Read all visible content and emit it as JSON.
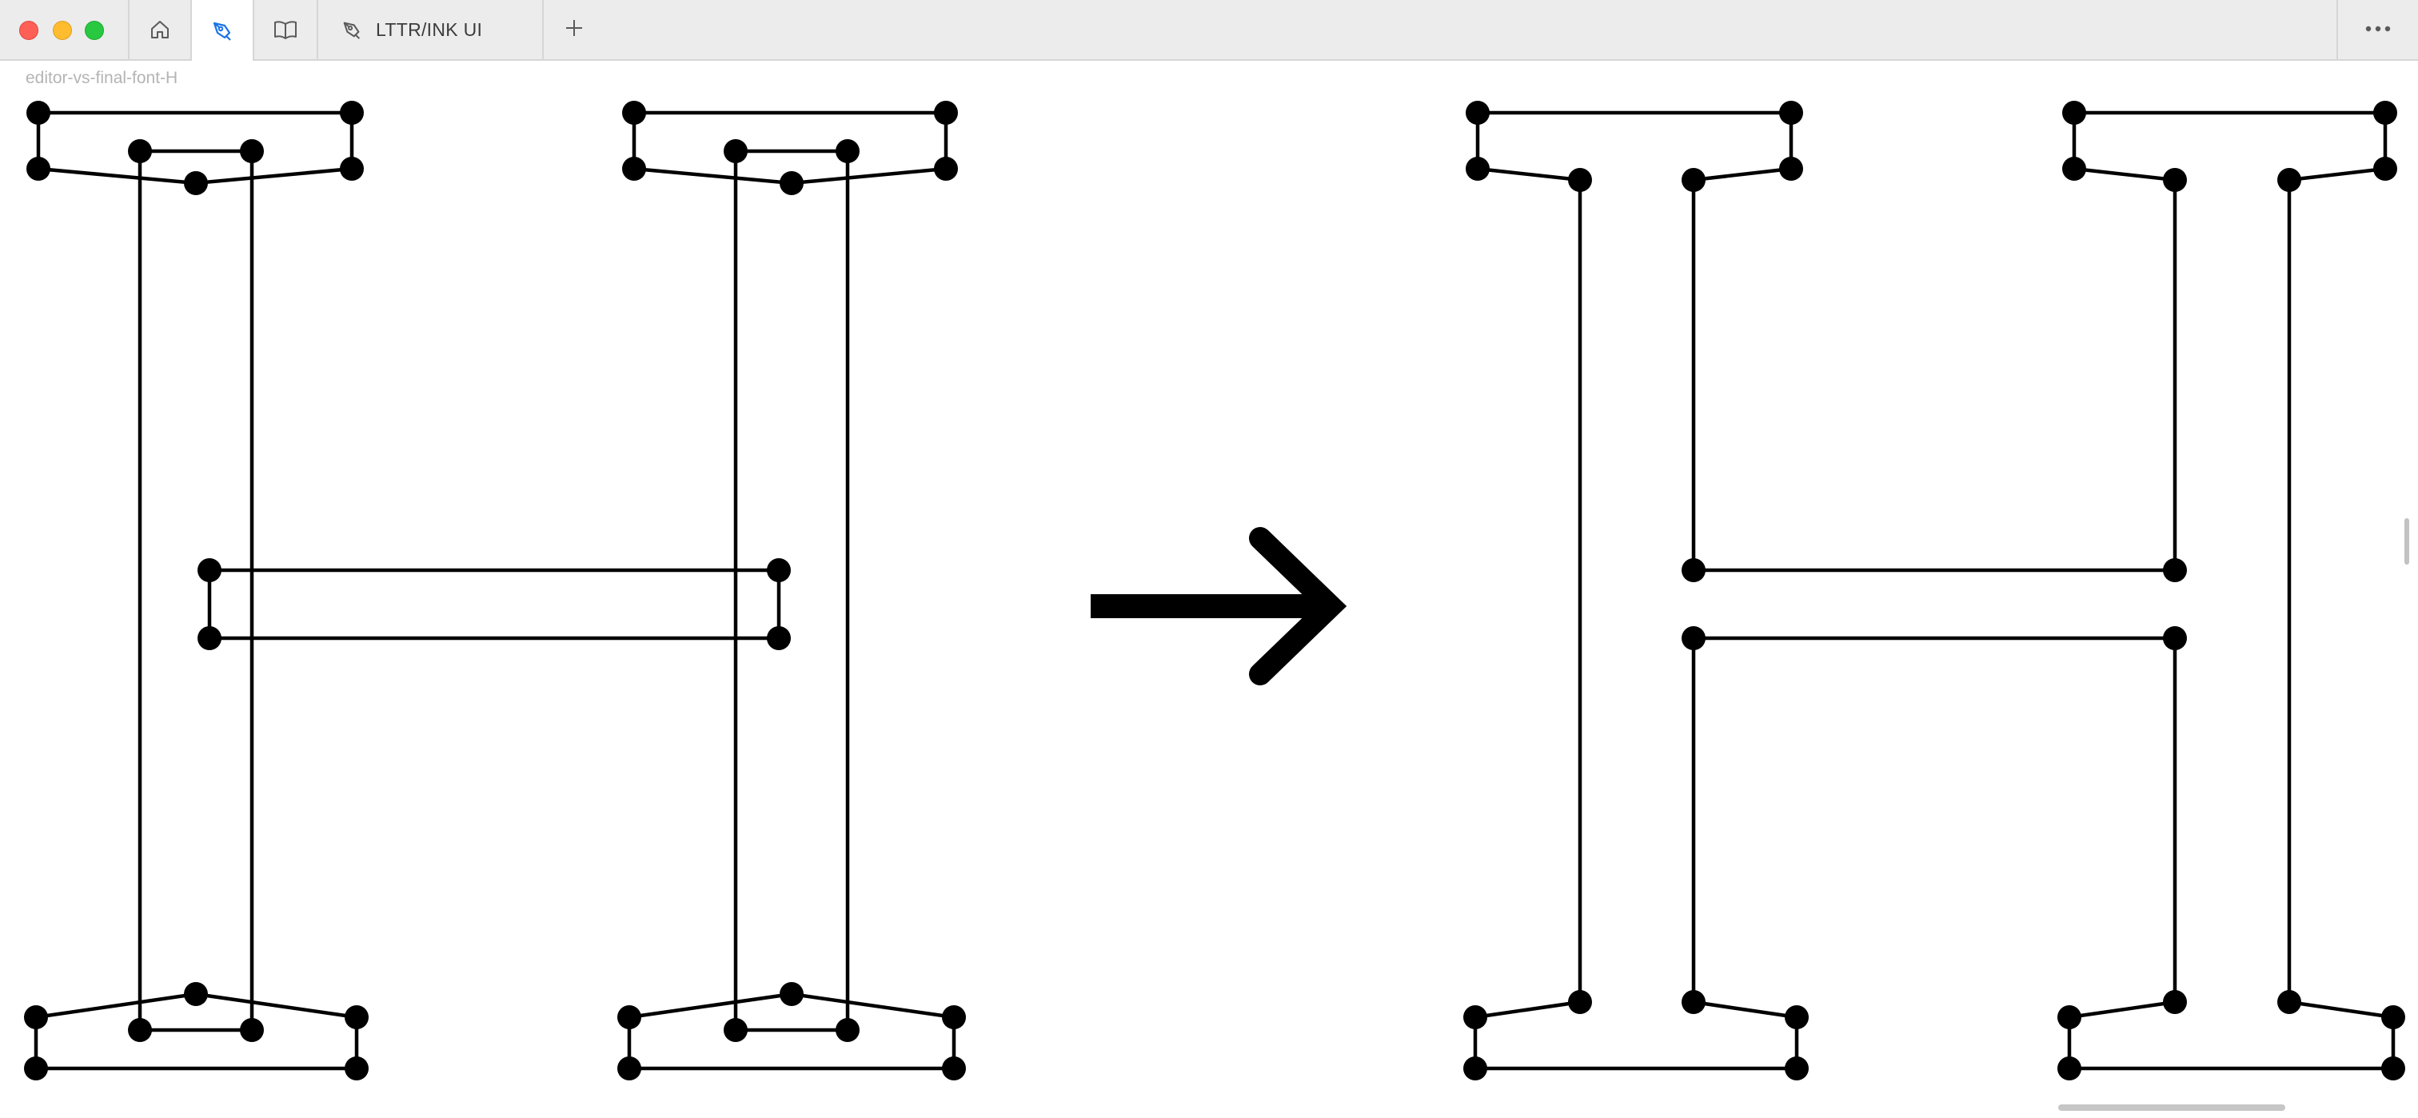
{
  "window": {
    "tabs": [
      {
        "name": "home",
        "icon": "home-icon"
      },
      {
        "name": "editor",
        "icon": "pen-nib-icon",
        "active": true
      },
      {
        "name": "book",
        "icon": "book-icon"
      },
      {
        "name": "document",
        "icon": "pen-nib-icon",
        "label": "LTTR/INK UI"
      }
    ],
    "new_tab_icon": "plus-icon",
    "more_icon": "more-icon"
  },
  "document": {
    "title": "editor-vs-final-font-H"
  },
  "illustration": {
    "left_glyph": "H (editor outlines with control points)",
    "right_glyph": "H (final font outline)",
    "arrow_icon": "arrow-right-icon"
  },
  "colors": {
    "accent": "#1a73e8",
    "titlebar": "#ececec",
    "ink": "#000000"
  }
}
